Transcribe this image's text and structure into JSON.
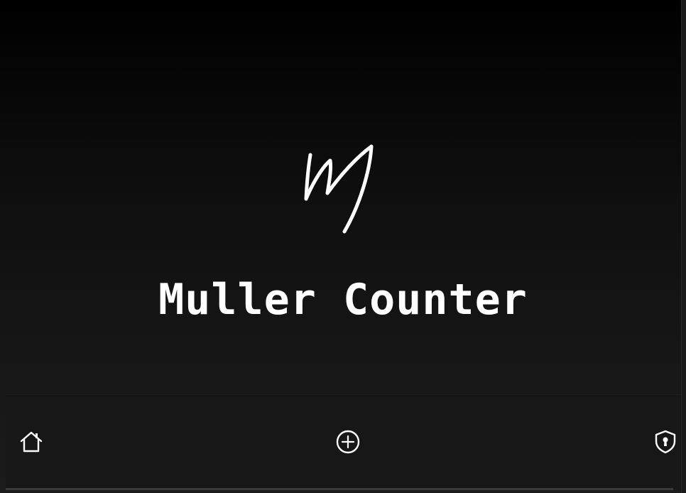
{
  "app": {
    "title": "Muller Counter"
  },
  "logo": {
    "icon": "signature-m-logo"
  },
  "nav": {
    "items": [
      {
        "id": "home",
        "icon": "home-icon"
      },
      {
        "id": "add",
        "icon": "plus-circle-icon"
      },
      {
        "id": "security",
        "icon": "shield-keyhole-icon"
      }
    ]
  },
  "colors": {
    "background_top": "#000000",
    "background_bottom": "#1b1b1b",
    "nav_background": "#171717",
    "foreground": "#ffffff"
  }
}
